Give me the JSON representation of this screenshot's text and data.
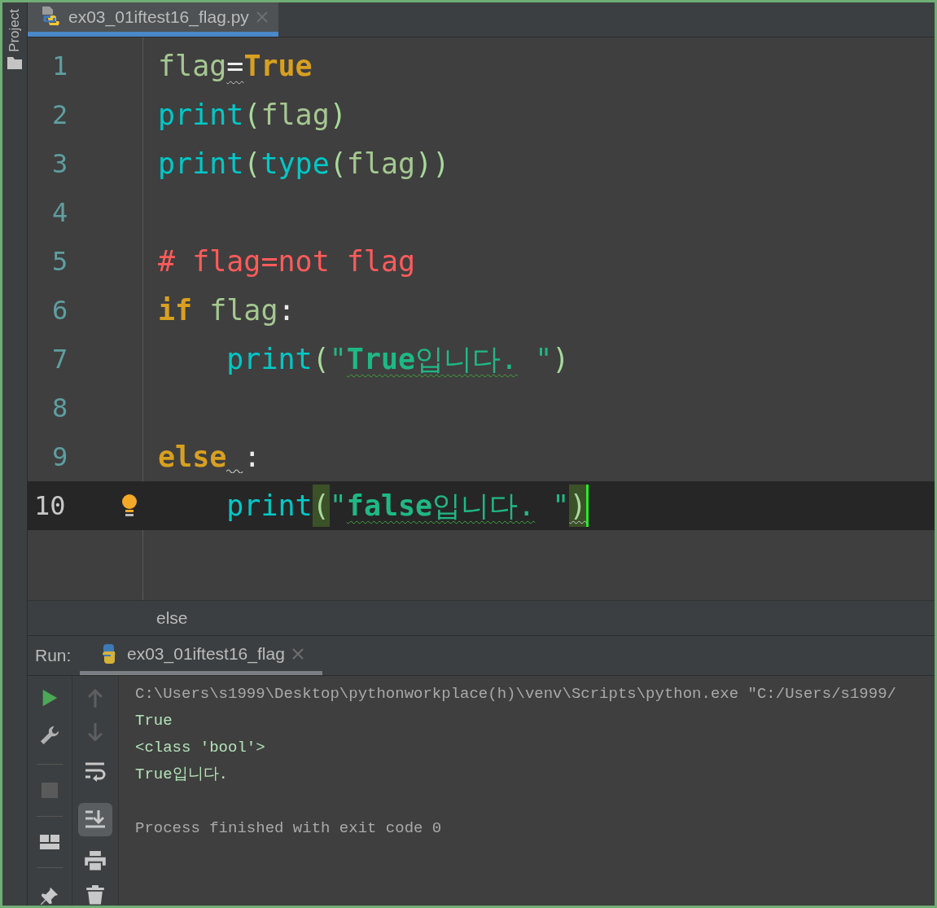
{
  "side_panel": {
    "label": "Project"
  },
  "editor_tabs": [
    {
      "label": "ex03_01iftest16_flag.py",
      "selected": true
    }
  ],
  "code_lines": [
    {
      "number": "1",
      "current": false,
      "tokens": [
        {
          "text": "flag",
          "kind": "var"
        },
        {
          "text": "=",
          "kind": "op",
          "weak_warning": true
        },
        {
          "text": "True",
          "kind": "kw"
        }
      ]
    },
    {
      "number": "2",
      "current": false,
      "tokens": [
        {
          "text": "print",
          "kind": "builtin"
        },
        {
          "text": "(",
          "kind": "paren"
        },
        {
          "text": "flag",
          "kind": "var"
        },
        {
          "text": ")",
          "kind": "paren"
        }
      ]
    },
    {
      "number": "3",
      "current": false,
      "tokens": [
        {
          "text": "print",
          "kind": "builtin"
        },
        {
          "text": "(",
          "kind": "paren"
        },
        {
          "text": "type",
          "kind": "builtin"
        },
        {
          "text": "(",
          "kind": "paren"
        },
        {
          "text": "flag",
          "kind": "var"
        },
        {
          "text": "))",
          "kind": "paren"
        }
      ]
    },
    {
      "number": "4",
      "current": false
    },
    {
      "number": "5",
      "current": false,
      "tokens": [
        {
          "text": "# flag=not flag",
          "kind": "comment"
        }
      ]
    },
    {
      "number": "6",
      "current": false,
      "tokens": [
        {
          "text": "if",
          "kind": "kw"
        },
        {
          "text": " flag",
          "kind": "var"
        },
        {
          "text": ":",
          "kind": "op"
        }
      ]
    },
    {
      "number": "7",
      "current": false,
      "tokens": [
        {
          "text": "    print",
          "kind": "builtin"
        },
        {
          "text": "(",
          "kind": "paren"
        },
        {
          "text": "\"",
          "kind": "string"
        },
        {
          "text": "**True**입니다.",
          "kind": "string",
          "typo": true
        },
        {
          "text": " \"",
          "kind": "string"
        },
        {
          "text": ")",
          "kind": "paren"
        }
      ]
    },
    {
      "number": "8",
      "current": false
    },
    {
      "number": "9",
      "current": false,
      "tokens": [
        {
          "text": "else",
          "kind": "kw"
        },
        {
          "text": ":",
          "kind": "op",
          "space_warning": true
        }
      ]
    },
    {
      "number": "10",
      "current": true,
      "bulb": true,
      "tokens": [
        {
          "text": "    print",
          "kind": "builtin"
        },
        {
          "text": "(",
          "kind": "paren",
          "matched": true
        },
        {
          "text": "\"",
          "kind": "string"
        },
        {
          "text": "**false**입니다.",
          "kind": "string",
          "typo": true
        },
        {
          "text": " \"",
          "kind": "string"
        },
        {
          "text": ")",
          "kind": "paren",
          "matched": true,
          "weak_warning": true,
          "caret": true
        }
      ]
    }
  ],
  "breadcrumb": "else",
  "run_panel": {
    "label": "Run:",
    "tabs": [
      {
        "label": "ex03_01iftest16_flag",
        "selected": true
      }
    ],
    "toggles": [
      {
        "kind": "soft-wrap",
        "on": false
      },
      {
        "kind": "scroll-to-end",
        "on": true
      }
    ],
    "console": [
      {
        "text": "C:\\Users\\s1999\\Desktop\\pythonworkplace(h)\\venv\\Scripts\\python.exe \"C:/Users/s1999/",
        "kind": "command"
      },
      {
        "text": "True",
        "kind": "output"
      },
      {
        "text": "<class 'bool'>",
        "kind": "output"
      },
      {
        "text": "True입니다.",
        "kind": "output"
      },
      {
        "text": "Process finished with exit code 0",
        "kind": "info"
      }
    ]
  }
}
